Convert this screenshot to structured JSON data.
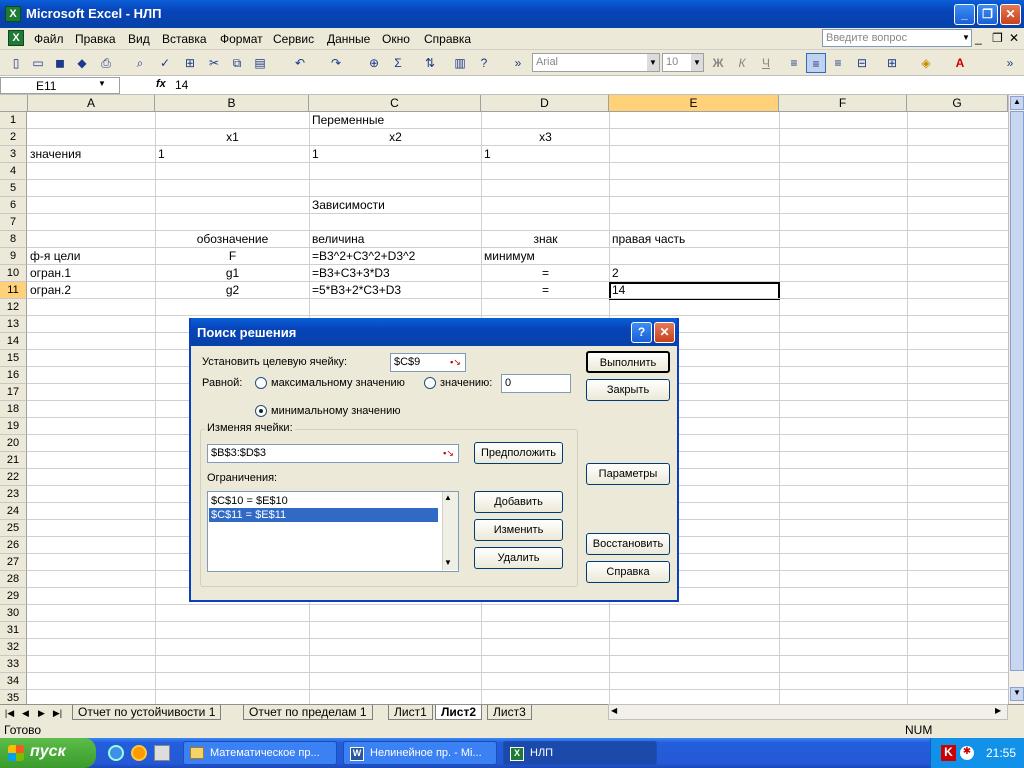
{
  "window": {
    "title": "Microsoft Excel - НЛП"
  },
  "menu": {
    "items": [
      "Файл",
      "Правка",
      "Вид",
      "Вставка",
      "Формат",
      "Сервис",
      "Данные",
      "Окно",
      "Справка"
    ],
    "help_placeholder": "Введите вопрос"
  },
  "toolbar": {
    "font": "Arial",
    "size": "10",
    "bold": "Ж",
    "italic": "К",
    "underline": "Ч",
    "sigma": "Σ"
  },
  "formula": {
    "cell_ref": "E11",
    "fx": "fx",
    "value": "14"
  },
  "columns": [
    "A",
    "B",
    "C",
    "D",
    "E",
    "F",
    "G"
  ],
  "rows": [
    "1",
    "2",
    "3",
    "4",
    "5",
    "6",
    "7",
    "8",
    "9",
    "10",
    "11",
    "12",
    "13",
    "14",
    "15",
    "16",
    "17",
    "18",
    "19",
    "20",
    "21",
    "22",
    "23",
    "24",
    "25",
    "26",
    "27",
    "28",
    "29",
    "30",
    "31",
    "32",
    "33",
    "34",
    "35"
  ],
  "cells": {
    "r1c": "Переменные",
    "r2b": "x1",
    "r2c": "x2",
    "r2d": "x3",
    "r3a": "значения",
    "r3b": "1",
    "r3c": "1",
    "r3d": "1",
    "r6c": "Зависимости",
    "r8b": "обозначение",
    "r8c": "величина",
    "r8d": "знак",
    "r8e": "правая часть",
    "r9a": "ф-я цели",
    "r9b": "F",
    "r9c": "=B3^2+C3^2+D3^2",
    "r9d": "минимум",
    "r10a": "огран.1",
    "r10b": "g1",
    "r10c": "=B3+C3+3*D3",
    "r10d": "=",
    "r10e": "2",
    "r11a": "огран.2",
    "r11b": "g2",
    "r11c": "=5*B3+2*C3+D3",
    "r11d": "=",
    "r11e": "14"
  },
  "tabs": [
    "Отчет по устойчивости 1",
    "Отчет по пределам 1",
    "Лист1",
    "Лист2",
    "Лист3"
  ],
  "status": {
    "left": "Готово",
    "num": "NUM"
  },
  "dialog": {
    "title": "Поиск решения",
    "help_q": "?",
    "target_label": "Установить целевую ячейку:",
    "target_value": "$C$9",
    "equal_label": "Равной:",
    "max_label": "максимальному значению",
    "value_label": "значению:",
    "value_value": "0",
    "min_label": "минимальному значению",
    "changing_label": "Изменяя ячейки:",
    "changing_value": "$B$3:$D$3",
    "guess_btn": "Предположить",
    "constraints_label": "Ограничения:",
    "constraints": [
      "$C$10 = $E$10",
      "$C$11 = $E$11"
    ],
    "add_btn": "Добавить",
    "change_btn": "Изменить",
    "delete_btn": "Удалить",
    "solve_btn": "Выполнить",
    "close_btn": "Закрыть",
    "params_btn": "Параметры",
    "reset_btn": "Восстановить",
    "help_btn": "Справка"
  },
  "taskbar": {
    "start": "пуск",
    "tasks": [
      "Математическое пр...",
      "Нелинейное пр. - Mi...",
      "НЛП"
    ],
    "clock": "21:55"
  }
}
